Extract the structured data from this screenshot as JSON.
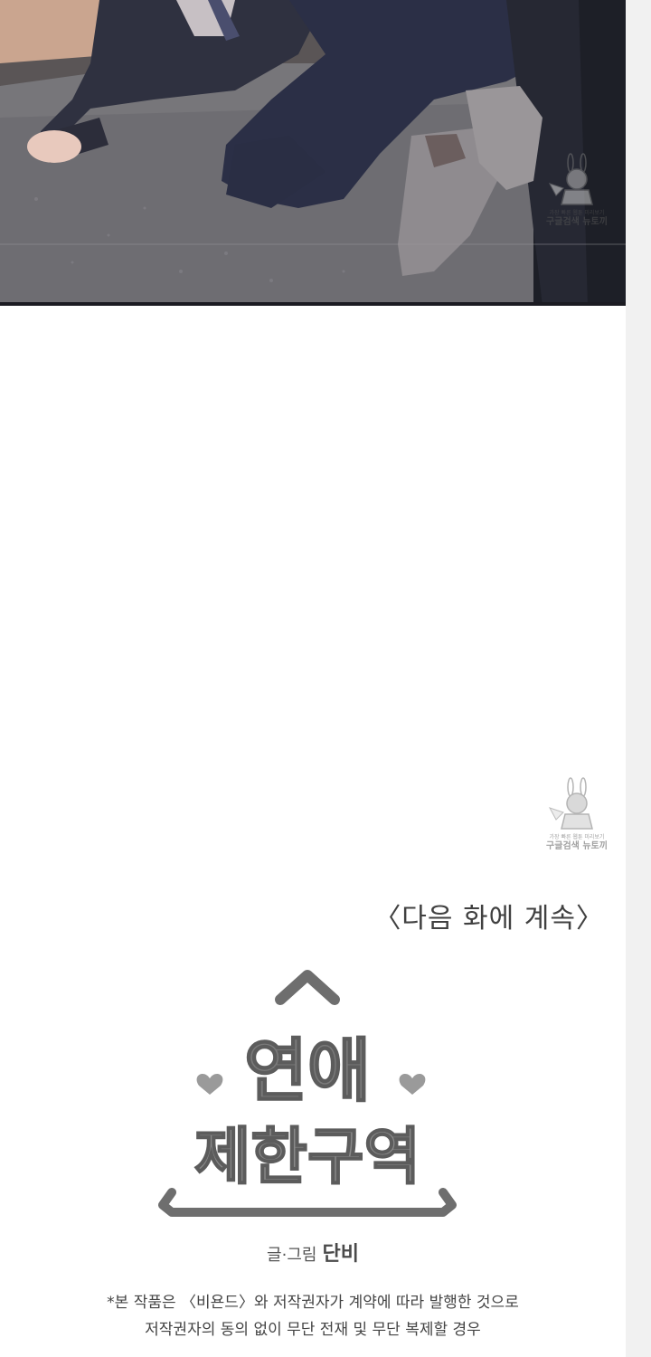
{
  "watermark": {
    "line1": "가장 빠른 웹툰 미리보기",
    "line2": "구글검색 뉴토끼"
  },
  "ending": {
    "next_episode": "〈다음 화에 계속〉",
    "logo_line1": "연애",
    "logo_line2": "제한구역",
    "credit_label": "글·그림",
    "credit_author": "단비",
    "notice_line1": "*본 작품은 〈비욘드〉와 저작권자가 계약에 따라 발행한 것으로",
    "notice_line2": "저작권자의 동의 없이 무단 전재 및 무단 복제할 경우"
  }
}
